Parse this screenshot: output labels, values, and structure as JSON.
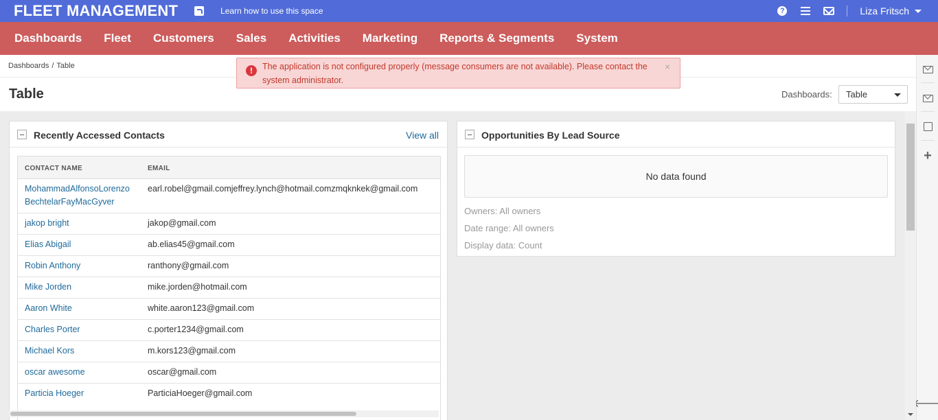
{
  "app": {
    "brand": "FLEET MANAGEMENT",
    "learn_link": "Learn how to use this space",
    "user_name": "Liza Fritsch"
  },
  "nav": {
    "items": [
      "Dashboards",
      "Fleet",
      "Customers",
      "Sales",
      "Activities",
      "Marketing",
      "Reports & Segments",
      "System"
    ]
  },
  "breadcrumb": {
    "parent": "Dashboards",
    "sep": "/",
    "current": "Table"
  },
  "page": {
    "title": "Table",
    "dashboards_label": "Dashboards:",
    "dashboards_selected": "Table"
  },
  "alert": {
    "message": "The application is not configured properly (message consumers are not available). Please contact the system administrator.",
    "close": "×"
  },
  "contacts_widget": {
    "title": "Recently Accessed Contacts",
    "view_all": "View all",
    "columns": [
      "CONTACT NAME",
      "EMAIL"
    ],
    "rows": [
      {
        "name_line1": "MohammadAlfonsoLorenzo",
        "name_line2": "BechtelarFayMacGyver",
        "email": "earl.robel@gmail.comjeffrey.lynch@hotmail.comzmqknkek@gmail.com"
      },
      {
        "name_line1": "jakop bright",
        "name_line2": "",
        "email": "jakop@gmail.com"
      },
      {
        "name_line1": "Elias Abigail",
        "name_line2": "",
        "email": "ab.elias45@gmail.com"
      },
      {
        "name_line1": "Robin Anthony",
        "name_line2": "",
        "email": "ranthony@gmail.com"
      },
      {
        "name_line1": "Mike Jorden",
        "name_line2": "",
        "email": "mike.jorden@hotmail.com"
      },
      {
        "name_line1": "Aaron White",
        "name_line2": "",
        "email": "white.aaron123@gmail.com"
      },
      {
        "name_line1": "Charles Porter",
        "name_line2": "",
        "email": "c.porter1234@gmail.com"
      },
      {
        "name_line1": "Michael Kors",
        "name_line2": "",
        "email": "m.kors123@gmail.com"
      },
      {
        "name_line1": "oscar awesome",
        "name_line2": "",
        "email": "oscar@gmail.com"
      },
      {
        "name_line1": "Particia Hoeger",
        "name_line2": "",
        "email": "ParticiaHoeger@gmail.com"
      }
    ]
  },
  "opps_widget": {
    "title": "Opportunities By Lead Source",
    "no_data": "No data found",
    "owners": "Owners: All owners",
    "date_range": "Date range: All owners",
    "display_data": "Display data: Count"
  },
  "sidebar": {
    "icons": [
      "mail-icon",
      "mail-icon",
      "note-icon",
      "plus-icon",
      "arrow-left-icon"
    ],
    "plus": "+",
    "arrow": "🡐"
  },
  "colors": {
    "topbar": "#516cd8",
    "nav": "#cd5c5c",
    "link": "#1f6a9a",
    "alert_bg": "#f9d6d6",
    "alert_text": "#c0392b"
  }
}
